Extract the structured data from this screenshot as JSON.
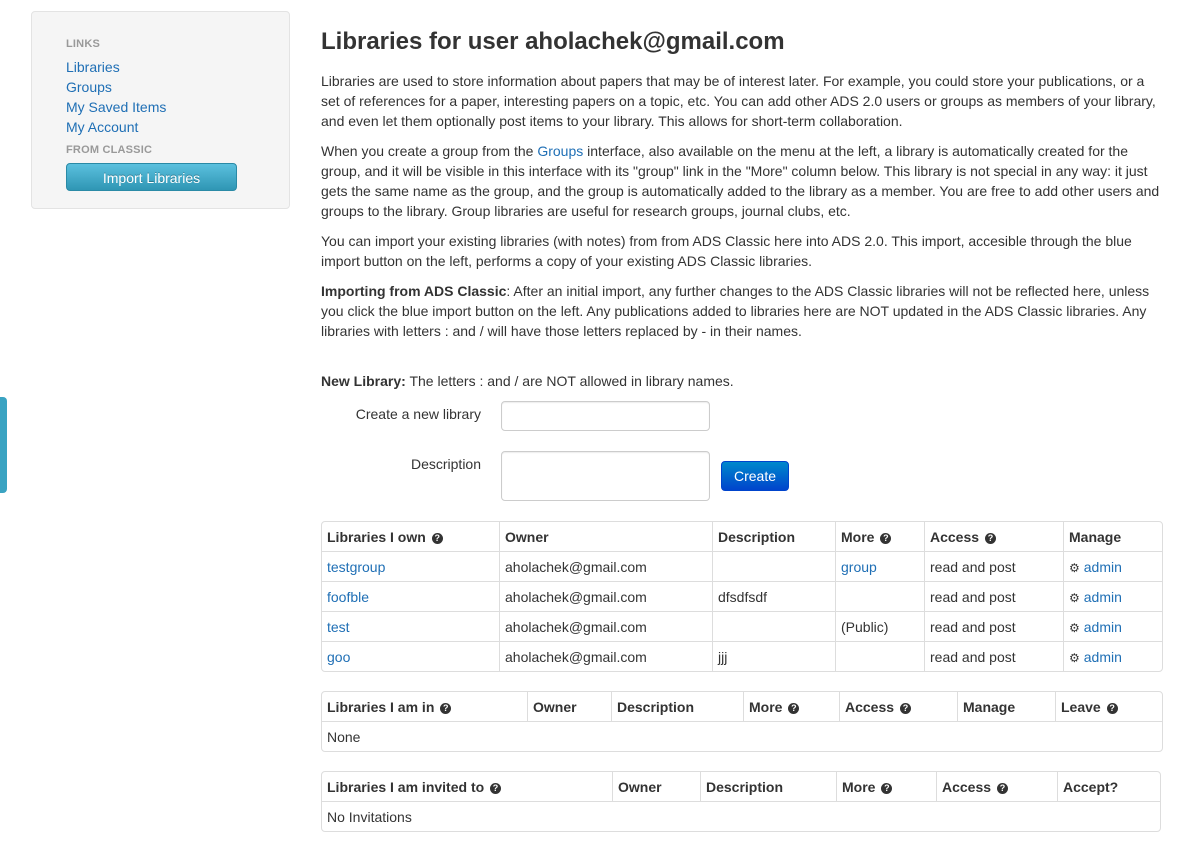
{
  "sidebar": {
    "links_header": "LINKS",
    "links": [
      "Libraries",
      "Groups",
      "My Saved Items",
      "My Account"
    ],
    "classic_header": "FROM CLASSIC",
    "import_button": "Import Libraries"
  },
  "page": {
    "title": "Libraries for user aholachek@gmail.com",
    "para1": "Libraries are used to store information about papers that may be of interest later. For example, you could store your publications, or a set of references for a paper, interesting papers on a topic, etc. You can add other ADS 2.0 users or groups as members of your library, and even let them optionally post items to your library. This allows for short-term collaboration.",
    "para2_pre": "When you create a group from the ",
    "para2_link": "Groups",
    "para2_post": " interface, also available on the menu at the left, a library is automatically created for the group, and it will be visible in this interface with its \"group\" link in the \"More\" column below. This library is not special in any way: it just gets the same name as the group, and the group is automatically added to the library as a member. You are free to add other users and groups to the library. Group libraries are useful for research groups, journal clubs, etc.",
    "para3": "You can import your existing libraries (with notes) from from ADS Classic here into ADS 2.0. This import, accesible through the blue import button on the left, performs a copy of your existing ADS Classic libraries.",
    "para4_bold": "Importing from ADS Classic",
    "para4_rest": ": After an initial import, any further changes to the ADS Classic libraries will not be reflected here, unless you click the blue import button on the left. Any publications added to libraries here are NOT updated in the ADS Classic libraries. Any libraries with letters : and / will have those letters replaced by - in their names."
  },
  "new_library": {
    "bold": "New Library:",
    "note": " The letters : and / are NOT allowed in library names.",
    "create_label": "Create a new library",
    "name_value": "",
    "description_label": "Description",
    "description_value": "",
    "create_button": "Create"
  },
  "own_table": {
    "headers": [
      "Libraries I own",
      "Owner",
      "Description",
      "More",
      "Access",
      "Manage"
    ],
    "rows": [
      {
        "name": "testgroup",
        "owner": "aholachek@gmail.com",
        "description": "",
        "more": "group",
        "access": "read and post",
        "manage": "admin"
      },
      {
        "name": "foofble",
        "owner": "aholachek@gmail.com",
        "description": "dfsdfsdf",
        "more": "",
        "access": "read and post",
        "manage": "admin"
      },
      {
        "name": "test",
        "owner": "aholachek@gmail.com",
        "description": "",
        "more": "(Public)",
        "access": "read and post",
        "manage": "admin"
      },
      {
        "name": "goo",
        "owner": "aholachek@gmail.com",
        "description": "jjj",
        "more": "",
        "access": "read and post",
        "manage": "admin"
      }
    ]
  },
  "in_table": {
    "headers": [
      "Libraries I am in",
      "Owner",
      "Description",
      "More",
      "Access",
      "Manage",
      "Leave"
    ],
    "empty": "None"
  },
  "invited_table": {
    "headers": [
      "Libraries I am invited to",
      "Owner",
      "Description",
      "More",
      "Access",
      "Accept?"
    ],
    "empty": "No Invitations"
  },
  "icons": {
    "help": "question-circle-icon",
    "manage": "gear-icon"
  },
  "colors": {
    "link": "#1f6fb5",
    "import_button": "#3aa3c2",
    "create_button": "#0055cc"
  }
}
